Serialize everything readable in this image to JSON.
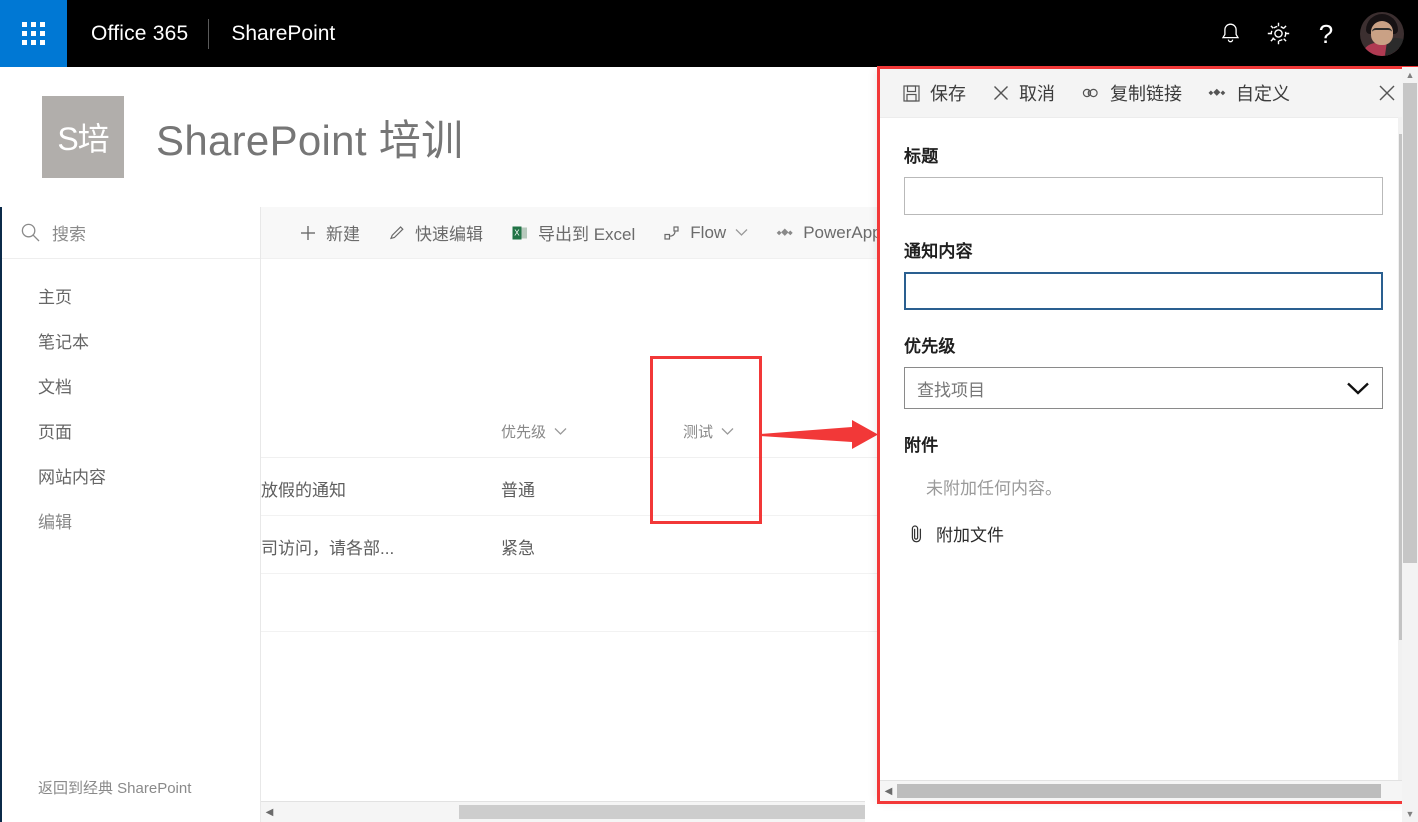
{
  "suitebar": {
    "waffle_name": "app-launcher",
    "brand": "Office 365",
    "app": "SharePoint",
    "notifications_icon": "bell-icon",
    "settings_icon": "gear-icon",
    "help_icon": "question-mark-icon",
    "help_glyph": "?",
    "avatar_name": "user-avatar",
    "bg_color": "#000000",
    "waffle_color": "#0078d4"
  },
  "site": {
    "logo_text": "S培",
    "title": "SharePoint 培训",
    "logo_bg": "#b1aeab"
  },
  "search": {
    "placeholder": "搜索",
    "icon": "search-icon"
  },
  "nav": {
    "items": [
      {
        "label": "主页"
      },
      {
        "label": "笔记本"
      },
      {
        "label": "文档"
      },
      {
        "label": "页面"
      },
      {
        "label": "网站内容"
      },
      {
        "label": "编辑"
      }
    ],
    "classic_link": "返回到经典 SharePoint"
  },
  "commandbar": {
    "items": [
      {
        "label": "新建",
        "icon": "plus-icon",
        "chevron": false
      },
      {
        "label": "快速编辑",
        "icon": "pencil-icon",
        "chevron": false
      },
      {
        "label": "导出到 Excel",
        "icon": "excel-icon",
        "chevron": false
      },
      {
        "label": "Flow",
        "icon": "flow-icon",
        "chevron": true
      },
      {
        "label": "PowerApps",
        "icon": "powerapps-icon",
        "chevron": false
      }
    ]
  },
  "list": {
    "columns": [
      {
        "label": "优先级",
        "sortable": true
      },
      {
        "label": "测试",
        "sortable": true,
        "highlighted": true
      }
    ],
    "rows": [
      {
        "title": "放假的通知",
        "priority": "普通",
        "test": ""
      },
      {
        "title": "司访问，请各部...",
        "priority": "紧急",
        "test": ""
      }
    ]
  },
  "annotation": {
    "color": "#f23838",
    "box_label": "highlight-test-column",
    "arrow_label": "arrow-to-panel",
    "panel_label": "highlight-form-panel"
  },
  "panel": {
    "toolbar": [
      {
        "label": "保存",
        "icon": "save-icon"
      },
      {
        "label": "取消",
        "icon": "close-x-icon"
      },
      {
        "label": "复制链接",
        "icon": "link-icon"
      },
      {
        "label": "自定义",
        "icon": "diamonds-icon"
      }
    ],
    "close_icon": "close-icon",
    "fields": [
      {
        "label": "标题",
        "value": "",
        "placeholder": "",
        "focused": false
      },
      {
        "label": "通知内容",
        "value": "",
        "placeholder": "",
        "focused": true
      }
    ],
    "lookup": {
      "label": "优先级",
      "placeholder": "查找项目",
      "value": "",
      "chevron_icon": "chevron-down-icon"
    },
    "attachments": {
      "label": "附件",
      "empty_text": "未附加任何内容。",
      "attach_label": "附加文件",
      "attach_icon": "paperclip-icon"
    }
  },
  "scrollbars": {
    "left_arrow": "◀",
    "right_arrow": "▶",
    "up_arrow": "▲",
    "down_arrow": "▼"
  }
}
